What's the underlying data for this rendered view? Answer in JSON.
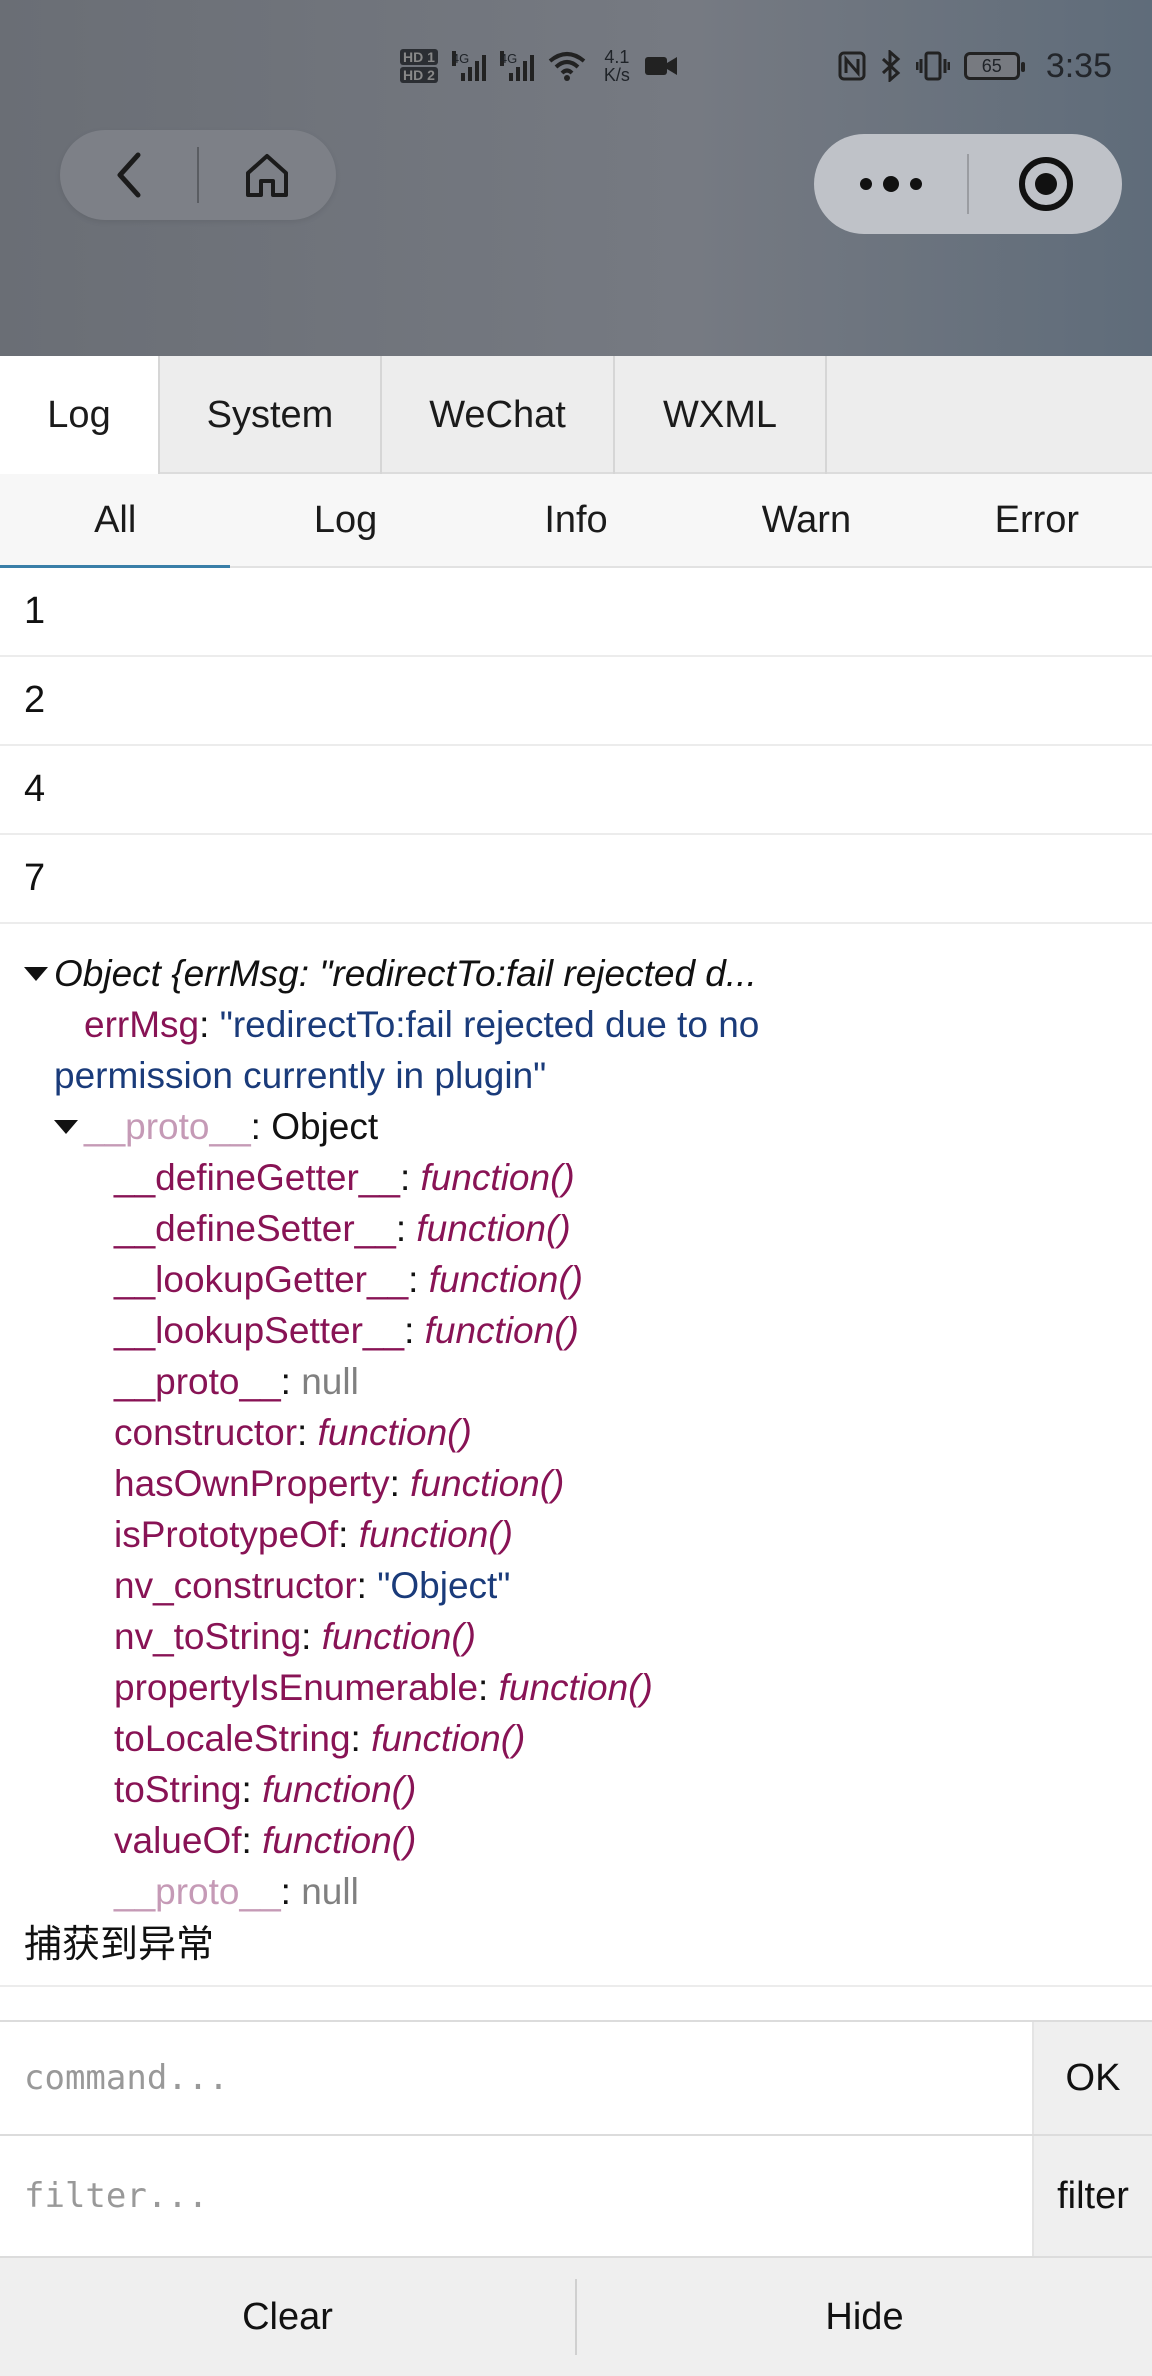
{
  "status_bar": {
    "hd1": "HD 1",
    "hd2": "HD 2",
    "net1": "4G",
    "net2": "4G",
    "speed_value": "4.1",
    "speed_unit": "K/s",
    "battery": "65",
    "time": "3:35"
  },
  "nav": {
    "back_icon": "chevron-left-icon",
    "home_icon": "home-icon",
    "more_icon": "more-dots-icon",
    "close_icon": "record-circle-icon"
  },
  "tabs": [
    {
      "label": "Log",
      "active": true
    },
    {
      "label": "System",
      "active": false
    },
    {
      "label": "WeChat",
      "active": false
    },
    {
      "label": "WXML",
      "active": false
    }
  ],
  "subtabs": [
    {
      "label": "All",
      "active": true
    },
    {
      "label": "Log",
      "active": false
    },
    {
      "label": "Info",
      "active": false
    },
    {
      "label": "Warn",
      "active": false
    },
    {
      "label": "Error",
      "active": false
    }
  ],
  "log_rows": [
    "1",
    "2",
    "4",
    "7"
  ],
  "object_log": {
    "summary": "Object {errMsg: \"redirectTo:fail rejected d...",
    "errmsg_key": "errMsg",
    "errmsg_value_1": "\"redirectTo:fail rejected due to no",
    "errmsg_value_2": "permission currently in plugin\"",
    "proto_key": "__proto__",
    "proto_type": "Object",
    "props": [
      {
        "key": "__defineGetter__",
        "value": "function()",
        "kind": "fn"
      },
      {
        "key": "__defineSetter__",
        "value": "function()",
        "kind": "fn"
      },
      {
        "key": "__lookupGetter__",
        "value": "function()",
        "kind": "fn"
      },
      {
        "key": "__lookupSetter__",
        "value": "function()",
        "kind": "fn"
      },
      {
        "key": "__proto__",
        "value": "null",
        "kind": "null"
      },
      {
        "key": "constructor",
        "value": "function()",
        "kind": "fn"
      },
      {
        "key": "hasOwnProperty",
        "value": "function()",
        "kind": "fn"
      },
      {
        "key": "isPrototypeOf",
        "value": "function()",
        "kind": "fn"
      },
      {
        "key": "nv_constructor",
        "value": "\"Object\"",
        "kind": "str"
      },
      {
        "key": "nv_toString",
        "value": "function()",
        "kind": "fn"
      },
      {
        "key": "propertyIsEnumerable",
        "value": "function()",
        "kind": "fn"
      },
      {
        "key": "toLocaleString",
        "value": "function()",
        "kind": "fn"
      },
      {
        "key": "toString",
        "value": "function()",
        "kind": "fn"
      },
      {
        "key": "valueOf",
        "value": "function()",
        "kind": "fn"
      },
      {
        "key": "__proto__",
        "value": "null",
        "kind": "null-faded"
      }
    ]
  },
  "caught_text": "捕获到异常",
  "command": {
    "placeholder": "command...",
    "button": "OK"
  },
  "filter": {
    "placeholder": "filter...",
    "button": "filter"
  },
  "footer": {
    "clear": "Clear",
    "hide": "Hide"
  }
}
